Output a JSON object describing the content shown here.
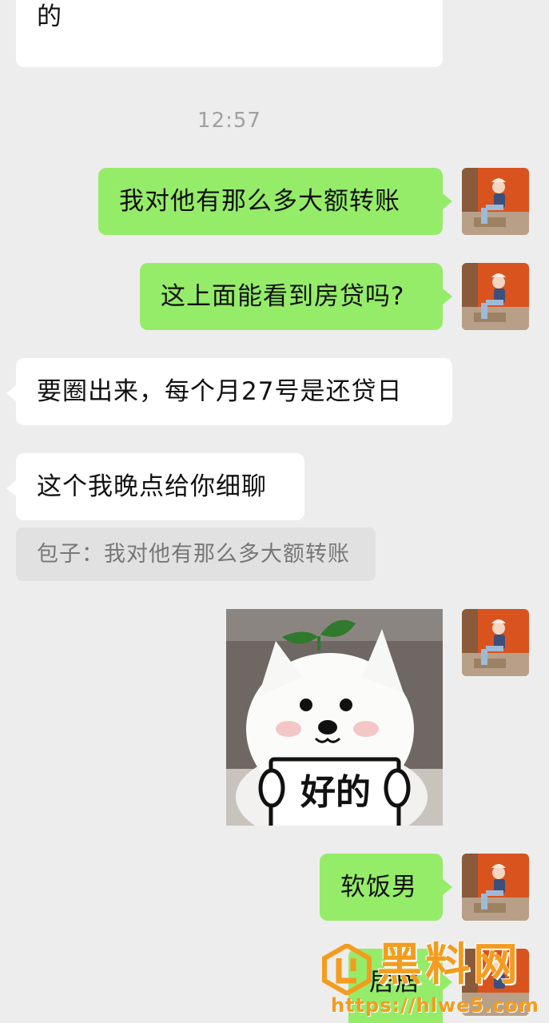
{
  "messages": {
    "m1": {
      "text": "我把银行给的表整理了一个简洁版的"
    },
    "time": "12:57",
    "m2": {
      "text": "我对他有那么多大额转账"
    },
    "m3": {
      "text": "这上面能看到房贷吗?"
    },
    "m4": {
      "text": "要圈出来，每个月27号是还贷日"
    },
    "m5": {
      "text": "这个我晚点给你细聊"
    },
    "quote": {
      "text": "包子：我对他有那么多大额转账"
    },
    "sticker": {
      "text": "好的"
    },
    "m6": {
      "text": "软饭男"
    },
    "m7": {
      "text": "居居"
    }
  },
  "watermark": {
    "brand": "黑料网",
    "url": "https://hlwe5.com"
  },
  "colors": {
    "background": "#ededed",
    "sent_bubble": "#95ec69",
    "received_bubble": "#ffffff",
    "brand_orange": "#f39c1f"
  }
}
